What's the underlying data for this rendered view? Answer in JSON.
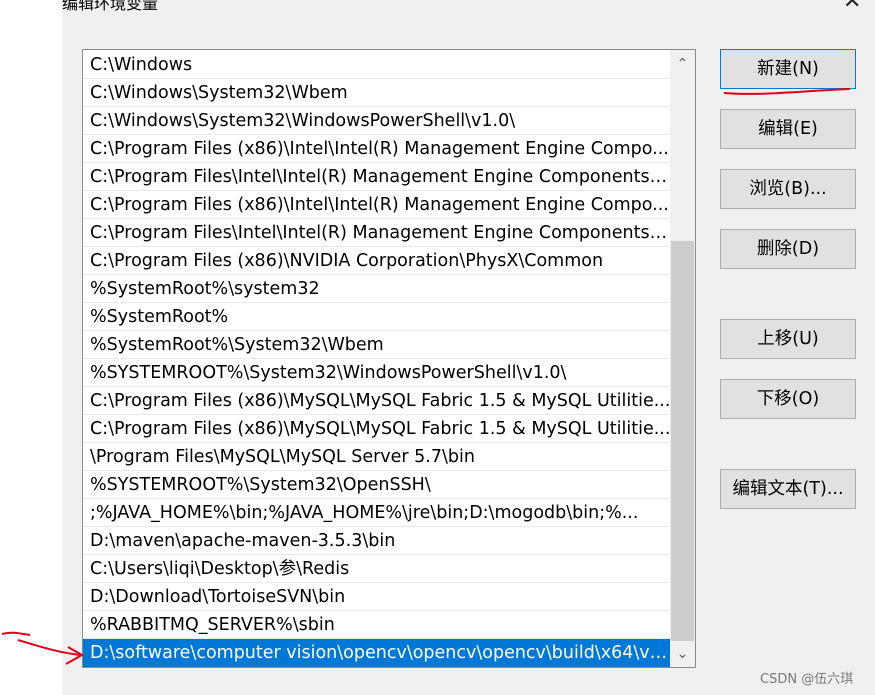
{
  "dialog": {
    "title": "编辑环境变量",
    "close_glyph": "✕"
  },
  "path_list": [
    "C:\\Windows",
    "C:\\Windows\\System32\\Wbem",
    "C:\\Windows\\System32\\WindowsPowerShell\\v1.0\\",
    "C:\\Program Files (x86)\\Intel\\Intel(R) Management Engine Compo...",
    "C:\\Program Files\\Intel\\Intel(R) Management Engine Components\\...",
    "C:\\Program Files (x86)\\Intel\\Intel(R) Management Engine Compo...",
    "C:\\Program Files\\Intel\\Intel(R) Management Engine Components\\...",
    "C:\\Program Files (x86)\\NVIDIA Corporation\\PhysX\\Common",
    "%SystemRoot%\\system32",
    "%SystemRoot%",
    "%SystemRoot%\\System32\\Wbem",
    "%SYSTEMROOT%\\System32\\WindowsPowerShell\\v1.0\\",
    "C:\\Program Files (x86)\\MySQL\\MySQL Fabric 1.5 & MySQL Utilitie...",
    "C:\\Program Files (x86)\\MySQL\\MySQL Fabric 1.5 & MySQL Utilitie...",
    "\\Program Files\\MySQL\\MySQL Server 5.7\\bin",
    "%SYSTEMROOT%\\System32\\OpenSSH\\",
    ";%JAVA_HOME%\\bin;%JAVA_HOME%\\jre\\bin;D:\\mogodb\\bin;%...",
    "D:\\maven\\apache-maven-3.5.3\\bin",
    "C:\\Users\\liqi\\Desktop\\参\\Redis",
    "D:\\Download\\TortoiseSVN\\bin",
    "%RABBITMQ_SERVER%\\sbin",
    "D:\\software\\computer vision\\opencv\\opencv\\opencv\\build\\x64\\vc..."
  ],
  "selected_index": 21,
  "buttons": {
    "new": "新建(N)",
    "edit": "编辑(E)",
    "browse": "浏览(B)...",
    "delete": "删除(D)",
    "move_up": "上移(U)",
    "move_down": "下移(O)",
    "edit_text": "编辑文本(T)..."
  },
  "scrollbar": {
    "up_glyph": "⌃",
    "down_glyph": "⌄"
  },
  "watermark": "CSDN @伍六琪",
  "colors": {
    "selection": "#0078d7",
    "annotation": "#e0001a"
  }
}
